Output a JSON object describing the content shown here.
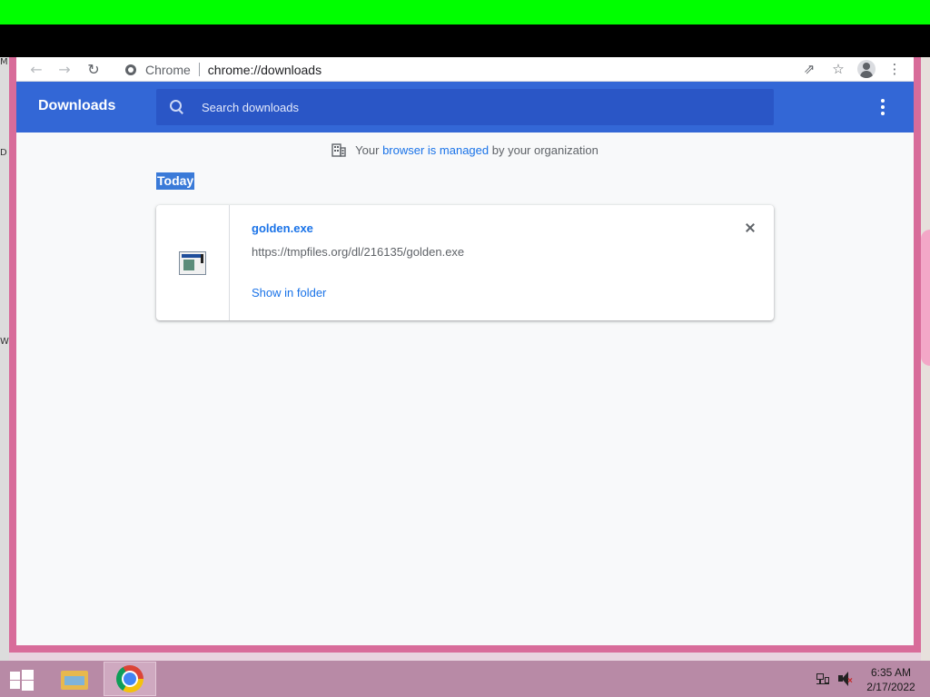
{
  "browser": {
    "origin_label": "Chrome",
    "url": "chrome://downloads"
  },
  "downloads_page": {
    "title": "Downloads",
    "search_placeholder": "Search downloads",
    "managed_notice": {
      "prefix": "Your",
      "link": "browser is managed",
      "suffix": "by your organization"
    },
    "section_title": "Today",
    "items": [
      {
        "file_name": "golden.exe",
        "url": "https://tmpfiles.org/dl/216135/golden.exe",
        "action_label": "Show in folder"
      }
    ]
  },
  "taskbar": {
    "clock_time": "6:35 AM",
    "clock_date": "2/17/2022"
  },
  "colors": {
    "header_blue": "#3367d6",
    "search_blue": "#2a56c6",
    "link_blue": "#1a73e8",
    "window_border_pink": "#d86c9a",
    "top_bar_green": "#00ff00"
  },
  "icons": [
    "back-icon",
    "forward-icon",
    "reload-icon",
    "site-info-icon",
    "share-icon",
    "star-icon",
    "profile-icon",
    "chrome-menu-icon",
    "search-icon",
    "more-actions-icon",
    "building-icon",
    "file-icon",
    "close-icon",
    "windows-start-icon",
    "file-explorer-icon",
    "chrome-icon",
    "network-icon",
    "volume-muted-icon"
  ]
}
